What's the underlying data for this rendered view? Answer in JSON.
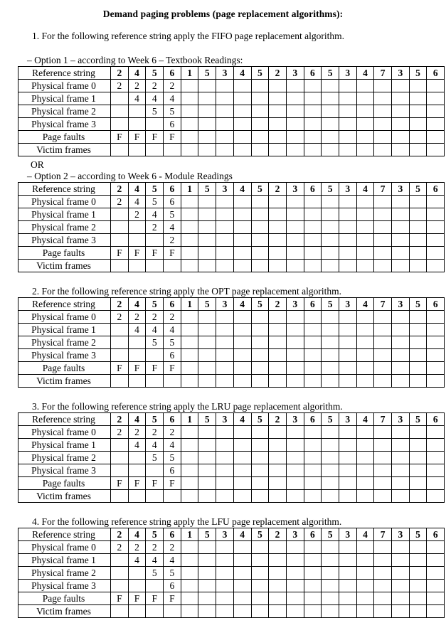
{
  "document": {
    "title": "Demand paging problems (page replacement algorithms):"
  },
  "labels": {
    "reference_string": "Reference string",
    "frame0": "Physical frame 0",
    "frame1": "Physical frame 1",
    "frame2": "Physical frame 2",
    "frame3": "Physical frame 3",
    "page_faults": "Page faults",
    "victim_frames": "Victim frames"
  },
  "reference_string": [
    "2",
    "4",
    "5",
    "6",
    "1",
    "5",
    "3",
    "4",
    "5",
    "2",
    "3",
    "6",
    "5",
    "3",
    "4",
    "7",
    "3",
    "5",
    "6"
  ],
  "or_text": "OR",
  "sections": [
    {
      "heading": "1. For the following reference string apply the FIFO page replacement algorithm.",
      "option1_heading": "– Option 1 – according to Week 6 – Textbook Readings:",
      "option2_heading": "– Option 2 – according to Week 6 - Module Readings"
    },
    {
      "heading": "2. For the following reference string apply the OPT page replacement algorithm."
    },
    {
      "heading": "3. For the following reference string apply the LRU page replacement algorithm."
    },
    {
      "heading": "4. For the following reference string apply the LFU page replacement algorithm."
    }
  ],
  "tables": {
    "fifo_option1": {
      "frame0": [
        "2",
        "2",
        "2",
        "2",
        "",
        "",
        "",
        "",
        "",
        "",
        "",
        "",
        "",
        "",
        "",
        "",
        "",
        "",
        ""
      ],
      "frame1": [
        "",
        "4",
        "4",
        "4",
        "",
        "",
        "",
        "",
        "",
        "",
        "",
        "",
        "",
        "",
        "",
        "",
        "",
        "",
        ""
      ],
      "frame2": [
        "",
        "",
        "5",
        "5",
        "",
        "",
        "",
        "",
        "",
        "",
        "",
        "",
        "",
        "",
        "",
        "",
        "",
        "",
        ""
      ],
      "frame3": [
        "",
        "",
        "",
        "6",
        "",
        "",
        "",
        "",
        "",
        "",
        "",
        "",
        "",
        "",
        "",
        "",
        "",
        "",
        ""
      ],
      "page_faults": [
        "F",
        "F",
        "F",
        "F",
        "",
        "",
        "",
        "",
        "",
        "",
        "",
        "",
        "",
        "",
        "",
        "",
        "",
        "",
        ""
      ],
      "victim_frames": [
        "",
        "",
        "",
        "",
        "",
        "",
        "",
        "",
        "",
        "",
        "",
        "",
        "",
        "",
        "",
        "",
        "",
        "",
        ""
      ]
    },
    "fifo_option2": {
      "frame0": [
        "2",
        "4",
        "5",
        "6",
        "",
        "",
        "",
        "",
        "",
        "",
        "",
        "",
        "",
        "",
        "",
        "",
        "",
        "",
        ""
      ],
      "frame1": [
        "",
        "2",
        "4",
        "5",
        "",
        "",
        "",
        "",
        "",
        "",
        "",
        "",
        "",
        "",
        "",
        "",
        "",
        "",
        ""
      ],
      "frame2": [
        "",
        "",
        "2",
        "4",
        "",
        "",
        "",
        "",
        "",
        "",
        "",
        "",
        "",
        "",
        "",
        "",
        "",
        "",
        ""
      ],
      "frame3": [
        "",
        "",
        "",
        "2",
        "",
        "",
        "",
        "",
        "",
        "",
        "",
        "",
        "",
        "",
        "",
        "",
        "",
        "",
        ""
      ],
      "page_faults": [
        "F",
        "F",
        "F",
        "F",
        "",
        "",
        "",
        "",
        "",
        "",
        "",
        "",
        "",
        "",
        "",
        "",
        "",
        "",
        ""
      ],
      "victim_frames": [
        "",
        "",
        "",
        "",
        "",
        "",
        "",
        "",
        "",
        "",
        "",
        "",
        "",
        "",
        "",
        "",
        "",
        "",
        ""
      ]
    },
    "opt": {
      "frame0": [
        "2",
        "2",
        "2",
        "2",
        "",
        "",
        "",
        "",
        "",
        "",
        "",
        "",
        "",
        "",
        "",
        "",
        "",
        "",
        ""
      ],
      "frame1": [
        "",
        "4",
        "4",
        "4",
        "",
        "",
        "",
        "",
        "",
        "",
        "",
        "",
        "",
        "",
        "",
        "",
        "",
        "",
        ""
      ],
      "frame2": [
        "",
        "",
        "5",
        "5",
        "",
        "",
        "",
        "",
        "",
        "",
        "",
        "",
        "",
        "",
        "",
        "",
        "",
        "",
        ""
      ],
      "frame3": [
        "",
        "",
        "",
        "6",
        "",
        "",
        "",
        "",
        "",
        "",
        "",
        "",
        "",
        "",
        "",
        "",
        "",
        "",
        ""
      ],
      "page_faults": [
        "F",
        "F",
        "F",
        "F",
        "",
        "",
        "",
        "",
        "",
        "",
        "",
        "",
        "",
        "",
        "",
        "",
        "",
        "",
        ""
      ],
      "victim_frames": [
        "",
        "",
        "",
        "",
        "",
        "",
        "",
        "",
        "",
        "",
        "",
        "",
        "",
        "",
        "",
        "",
        "",
        "",
        ""
      ]
    },
    "lru": {
      "frame0": [
        "2",
        "2",
        "2",
        "2",
        "",
        "",
        "",
        "",
        "",
        "",
        "",
        "",
        "",
        "",
        "",
        "",
        "",
        "",
        ""
      ],
      "frame1": [
        "",
        "4",
        "4",
        "4",
        "",
        "",
        "",
        "",
        "",
        "",
        "",
        "",
        "",
        "",
        "",
        "",
        "",
        "",
        ""
      ],
      "frame2": [
        "",
        "",
        "5",
        "5",
        "",
        "",
        "",
        "",
        "",
        "",
        "",
        "",
        "",
        "",
        "",
        "",
        "",
        "",
        ""
      ],
      "frame3": [
        "",
        "",
        "",
        "6",
        "",
        "",
        "",
        "",
        "",
        "",
        "",
        "",
        "",
        "",
        "",
        "",
        "",
        "",
        ""
      ],
      "page_faults": [
        "F",
        "F",
        "F",
        "F",
        "",
        "",
        "",
        "",
        "",
        "",
        "",
        "",
        "",
        "",
        "",
        "",
        "",
        "",
        ""
      ],
      "victim_frames": [
        "",
        "",
        "",
        "",
        "",
        "",
        "",
        "",
        "",
        "",
        "",
        "",
        "",
        "",
        "",
        "",
        "",
        "",
        ""
      ]
    },
    "lfu": {
      "frame0": [
        "2",
        "2",
        "2",
        "2",
        "",
        "",
        "",
        "",
        "",
        "",
        "",
        "",
        "",
        "",
        "",
        "",
        "",
        "",
        ""
      ],
      "frame1": [
        "",
        "4",
        "4",
        "4",
        "",
        "",
        "",
        "",
        "",
        "",
        "",
        "",
        "",
        "",
        "",
        "",
        "",
        "",
        ""
      ],
      "frame2": [
        "",
        "",
        "5",
        "5",
        "",
        "",
        "",
        "",
        "",
        "",
        "",
        "",
        "",
        "",
        "",
        "",
        "",
        "",
        ""
      ],
      "frame3": [
        "",
        "",
        "",
        "6",
        "",
        "",
        "",
        "",
        "",
        "",
        "",
        "",
        "",
        "",
        "",
        "",
        "",
        "",
        ""
      ],
      "page_faults": [
        "F",
        "F",
        "F",
        "F",
        "",
        "",
        "",
        "",
        "",
        "",
        "",
        "",
        "",
        "",
        "",
        "",
        "",
        "",
        ""
      ],
      "victim_frames": [
        "",
        "",
        "",
        "",
        "",
        "",
        "",
        "",
        "",
        "",
        "",
        "",
        "",
        "",
        "",
        "",
        "",
        "",
        ""
      ]
    }
  }
}
